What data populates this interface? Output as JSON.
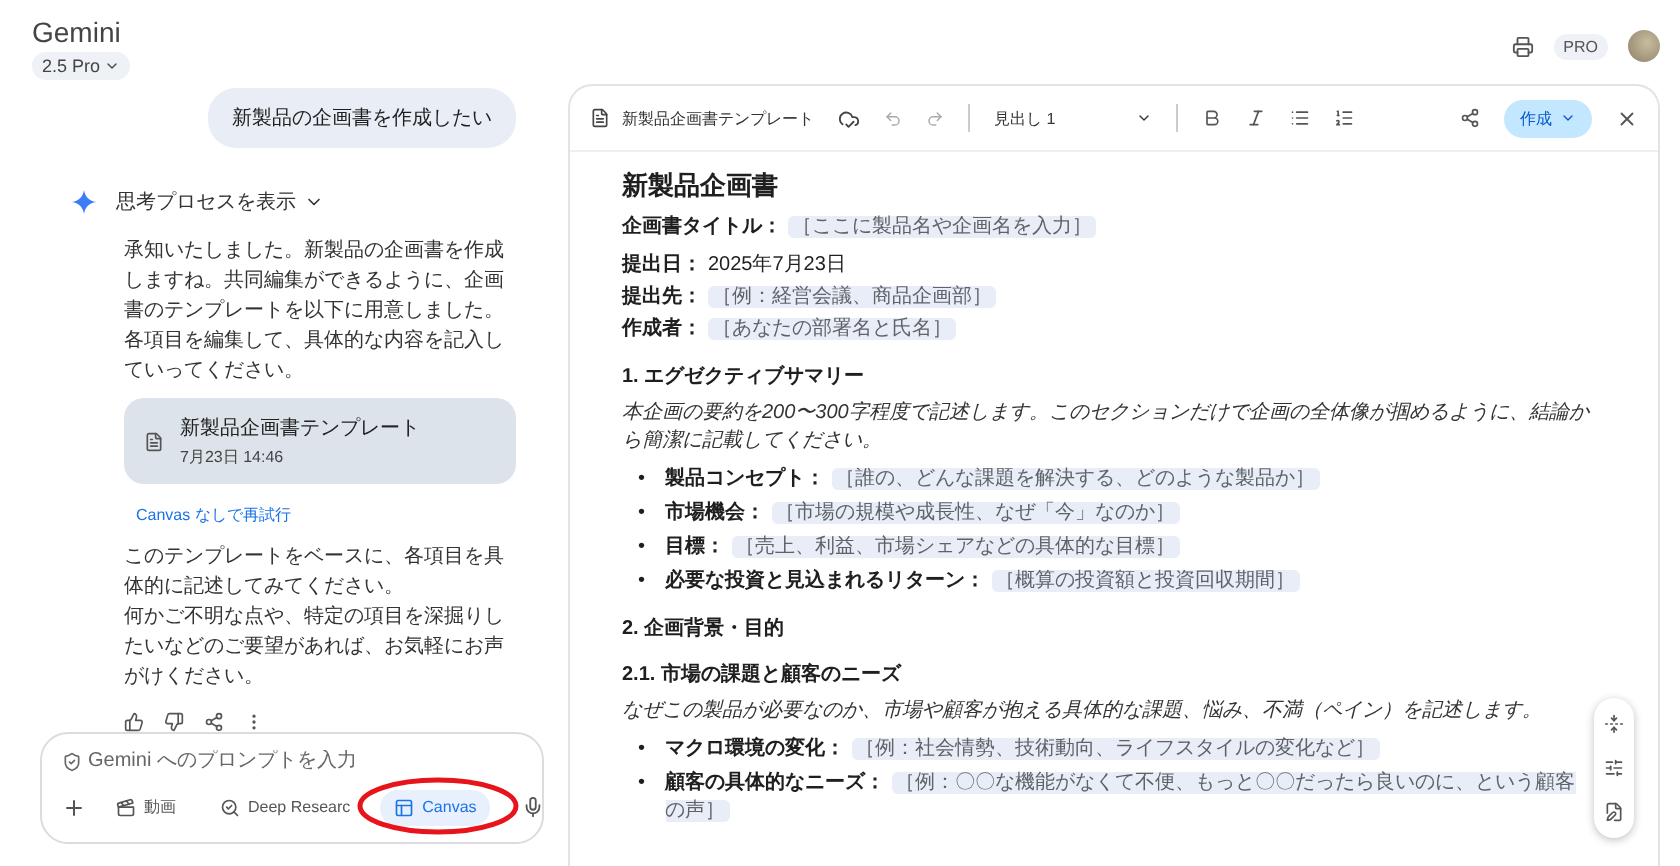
{
  "app": {
    "title": "Gemini",
    "model": "2.5 Pro",
    "badge": "PRO"
  },
  "chat": {
    "user_message": "新製品の企画書を作成したい",
    "thinking": {
      "label": "思考プロセスを表示",
      "expanded": false
    },
    "intro": [
      "承知いたしました。新製品の企画書を作成しますね。共同編集ができるように、企画書のテンプレートを以下に用意しました。各項目を編集して、具体的な内容を記入していってください。"
    ],
    "canvas_card": {
      "title": "新製品企画書テンプレート",
      "time": "7月23日 14:46"
    },
    "retry_link": "Canvas なしで再試行",
    "outro": [
      "このテンプレートをベースに、各項目を具体的に記述してみてください。",
      "何かご不明な点や、特定の項目を深掘りしたいなどのご要望があれば、お気軽にお声がけください。"
    ]
  },
  "prompt": {
    "placeholder": "Gemini へのプロンプトを入力",
    "tools": [
      {
        "kind": "video",
        "label": "動画",
        "selected": false,
        "highlighted": false
      },
      {
        "kind": "research",
        "label": "Deep Researc",
        "selected": false,
        "highlighted": false
      },
      {
        "kind": "canvas",
        "label": "Canvas",
        "selected": true,
        "highlighted": true
      }
    ]
  },
  "editor": {
    "doc_title": "新製品企画書テンプレート",
    "style": "見出し 1",
    "create_button": "作成",
    "blocks": [
      {
        "kind": "title",
        "text": "新製品企画書"
      },
      {
        "kind": "fields",
        "fields": [
          {
            "label": "企画書タイトル：",
            "chip": "［ここに製品名や企画名を入力］"
          }
        ]
      },
      {
        "kind": "fields",
        "fields": [
          {
            "label": "提出日：",
            "value": "2025年7月23日"
          },
          {
            "label": "提出先：",
            "chip": "［例：経営会議、商品企画部］"
          },
          {
            "label": "作成者：",
            "chip": "［あなたの部署名と氏名］"
          }
        ]
      },
      {
        "kind": "heading",
        "text": "1. エグゼクティブサマリー"
      },
      {
        "kind": "note",
        "text": "本企画の要約を200〜300字程度で記述します。このセクションだけで企画の全体像が掴めるように、結論から簡潔に記載してください。"
      },
      {
        "kind": "bullets",
        "marker": "•",
        "items": [
          {
            "label": "製品コンセプト：",
            "chip": "［誰の、どんな課題を解決する、どのような製品か］"
          },
          {
            "label": "市場機会：",
            "chip": "［市場の規模や成長性、なぜ「今」なのか］"
          },
          {
            "label": "目標：",
            "chip": "［売上、利益、市場シェアなどの具体的な目標］"
          },
          {
            "label": "必要な投資と見込まれるリターン：",
            "chip": "［概算の投資額と投資回収期間］"
          }
        ]
      },
      {
        "kind": "heading",
        "text": "2. 企画背景・目的"
      },
      {
        "kind": "heading",
        "text": "2.1. 市場の課題と顧客のニーズ"
      },
      {
        "kind": "note",
        "text": "なぜこの製品が必要なのか、市場や顧客が抱える具体的な課題、悩み、不満（ペイン）を記述します。"
      },
      {
        "kind": "bullets",
        "marker": "•",
        "items": [
          {
            "label": "マクロ環境の変化：",
            "chip": "［例：社会情勢、技術動向、ライフスタイルの変化など］"
          },
          {
            "label": "顧客の具体的なニーズ：",
            "chip": "［例：〇〇な機能がなくて不便、もっと〇〇だったら良いのに、という顧客の声］"
          }
        ]
      }
    ]
  }
}
